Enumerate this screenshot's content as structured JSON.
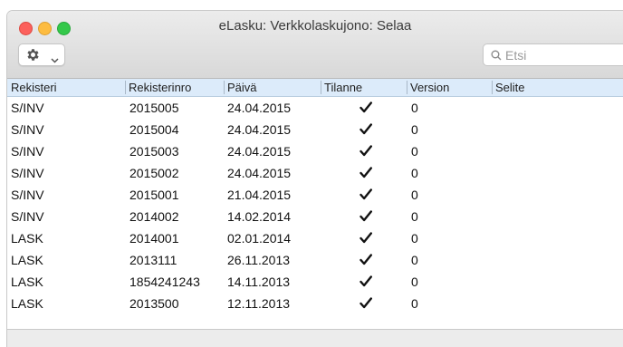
{
  "window": {
    "title": "eLasku: Verkkolaskujono: Selaa"
  },
  "toolbar": {
    "action_menu_icon": "gear-icon",
    "search_placeholder": "Etsi"
  },
  "table": {
    "columns": [
      "Rekisteri",
      "Rekisterinro",
      "Päivä",
      "Tilanne",
      "Version",
      "Selite"
    ],
    "rows": [
      {
        "rekisteri": "S/INV",
        "nro": "2015005",
        "paiva": "24.04.2015",
        "tilanne": true,
        "version": "0",
        "selite": ""
      },
      {
        "rekisteri": "S/INV",
        "nro": "2015004",
        "paiva": "24.04.2015",
        "tilanne": true,
        "version": "0",
        "selite": ""
      },
      {
        "rekisteri": "S/INV",
        "nro": "2015003",
        "paiva": "24.04.2015",
        "tilanne": true,
        "version": "0",
        "selite": ""
      },
      {
        "rekisteri": "S/INV",
        "nro": "2015002",
        "paiva": "24.04.2015",
        "tilanne": true,
        "version": "0",
        "selite": ""
      },
      {
        "rekisteri": "S/INV",
        "nro": "2015001",
        "paiva": "21.04.2015",
        "tilanne": true,
        "version": "0",
        "selite": ""
      },
      {
        "rekisteri": "S/INV",
        "nro": "2014002",
        "paiva": "14.02.2014",
        "tilanne": true,
        "version": "0",
        "selite": ""
      },
      {
        "rekisteri": "LASK",
        "nro": "2014001",
        "paiva": "02.01.2014",
        "tilanne": true,
        "version": "0",
        "selite": ""
      },
      {
        "rekisteri": "LASK",
        "nro": "2013111",
        "paiva": "26.11.2013",
        "tilanne": true,
        "version": "0",
        "selite": ""
      },
      {
        "rekisteri": "LASK",
        "nro": "1854241243",
        "paiva": "14.11.2013",
        "tilanne": true,
        "version": "0",
        "selite": ""
      },
      {
        "rekisteri": "LASK",
        "nro": "2013500",
        "paiva": "12.11.2013",
        "tilanne": true,
        "version": "0",
        "selite": ""
      }
    ]
  }
}
